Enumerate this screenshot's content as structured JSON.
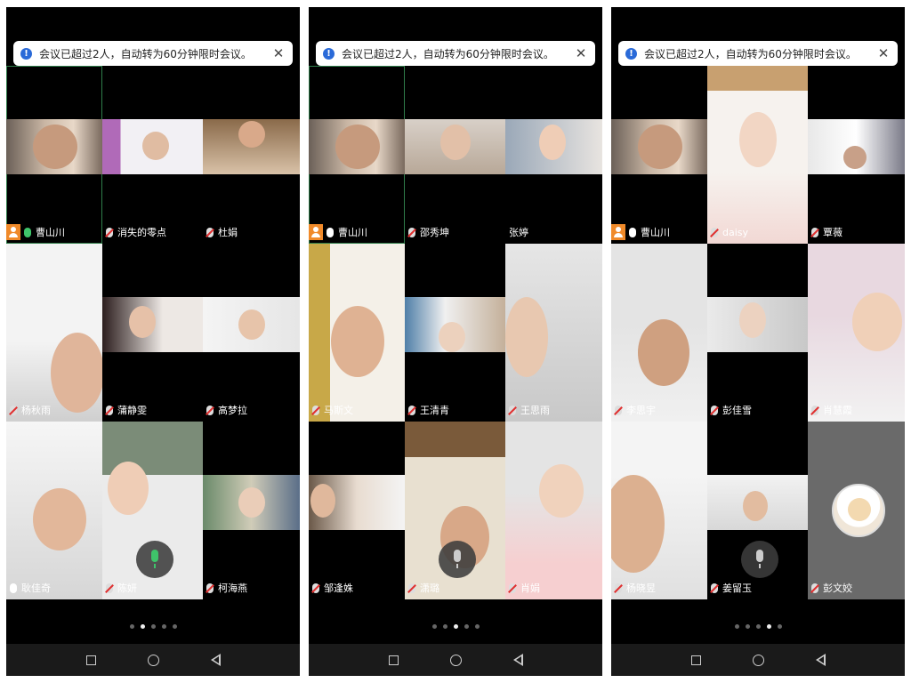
{
  "notice_text": "会议已超过2人，自动转为60分钟限时会议。",
  "colors": {
    "host_badge": "#f08a2a",
    "mic_active": "#3fc46a",
    "mic_muted_slash": "#e03030",
    "notice_info": "#2a6ad8"
  },
  "screens": [
    {
      "page_indicator": {
        "total": 5,
        "active": 1
      },
      "tiles": [
        {
          "name": "曹山川",
          "host": true,
          "mic": "on",
          "selected": true
        },
        {
          "name": "消失的零点",
          "mic": "muted"
        },
        {
          "name": "杜娟",
          "mic": "muted"
        },
        {
          "name": "杨秋雨",
          "mic": "muted"
        },
        {
          "name": "蒲静雯",
          "mic": "muted"
        },
        {
          "name": "高梦拉",
          "mic": "muted"
        },
        {
          "name": "耿佳奇",
          "mic": "plain"
        },
        {
          "name": "陈妍",
          "mic": "muted"
        },
        {
          "name": "柯海燕",
          "mic": "muted"
        }
      ]
    },
    {
      "page_indicator": {
        "total": 5,
        "active": 2
      },
      "tiles": [
        {
          "name": "曹山川",
          "host": true,
          "mic": "plain",
          "selected": true
        },
        {
          "name": "邵秀坤",
          "mic": "muted"
        },
        {
          "name": "张婷",
          "mic": "none"
        },
        {
          "name": "马斯文",
          "mic": "muted"
        },
        {
          "name": "王清青",
          "mic": "muted"
        },
        {
          "name": "王思雨",
          "mic": "muted"
        },
        {
          "name": "邹逢姝",
          "mic": "muted"
        },
        {
          "name": "潇璐",
          "mic": "muted"
        },
        {
          "name": "肖娟",
          "mic": "muted"
        }
      ]
    },
    {
      "page_indicator": {
        "total": 5,
        "active": 3
      },
      "tiles": [
        {
          "name": "曹山川",
          "host": true,
          "mic": "plain"
        },
        {
          "name": "daisy",
          "mic": "muted"
        },
        {
          "name": "覃薇",
          "mic": "muted"
        },
        {
          "name": "李思宇",
          "mic": "muted"
        },
        {
          "name": "彭佳雪",
          "mic": "muted"
        },
        {
          "name": "肖慧霞",
          "mic": "muted"
        },
        {
          "name": "杨晓昱",
          "mic": "muted"
        },
        {
          "name": "姜留玉",
          "mic": "muted"
        },
        {
          "name": "彭文姣",
          "mic": "muted",
          "avatar": "cartoon-bunny"
        }
      ]
    }
  ]
}
